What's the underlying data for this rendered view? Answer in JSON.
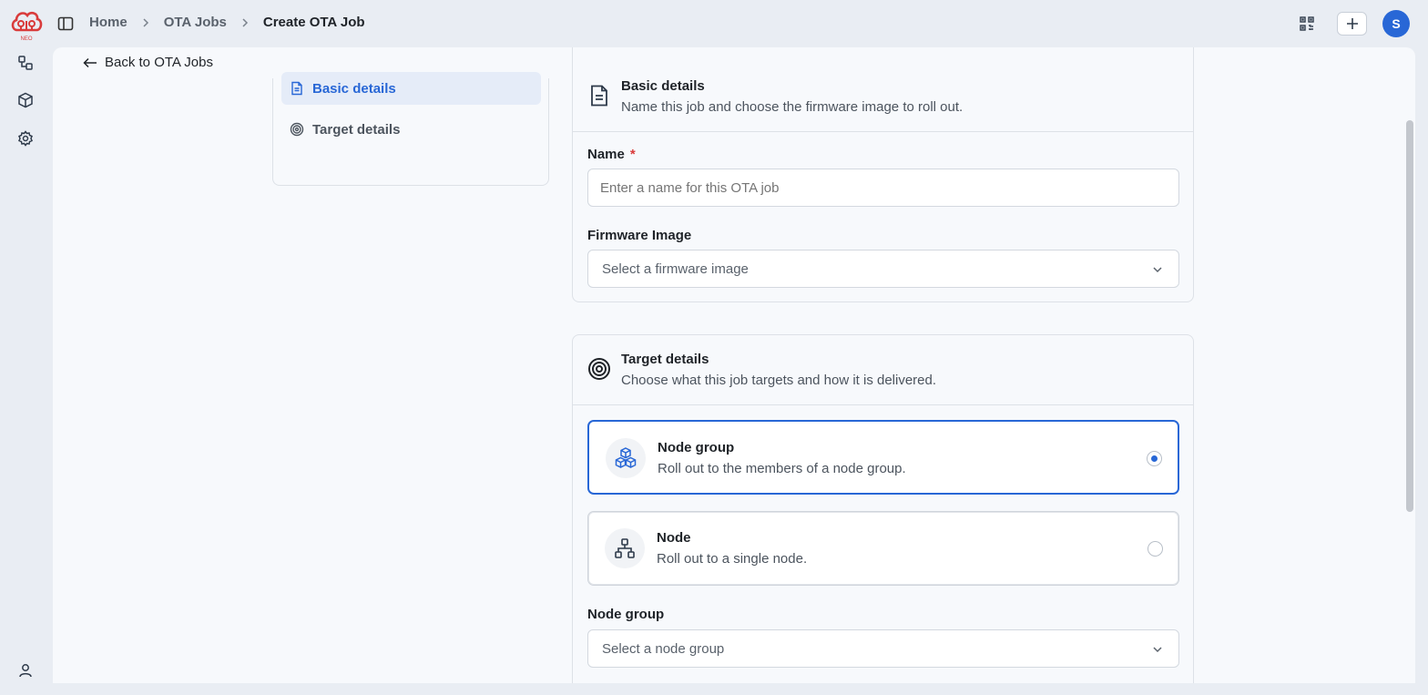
{
  "app": {
    "logo_icon": "cloud-logo-icon",
    "logo_text": "NEO"
  },
  "breadcrumb": {
    "items": [
      "Home",
      "OTA Jobs"
    ],
    "current": "Create OTA Job"
  },
  "topbar": {
    "qr_icon": "qr-code-icon",
    "add_icon": "plus-icon",
    "avatar_initial": "S"
  },
  "rail": {
    "items": [
      "nodes-icon",
      "package-icon",
      "settings-icon"
    ],
    "bottom": "user-icon"
  },
  "back_link": {
    "label": "Back to OTA Jobs"
  },
  "section_nav": {
    "items": [
      {
        "label": "Basic details",
        "icon": "document-icon",
        "active": true
      },
      {
        "label": "Target details",
        "icon": "target-icon",
        "active": false
      }
    ]
  },
  "basic_details": {
    "title": "Basic details",
    "subtitle": "Name this job and choose the firmware image to roll out.",
    "name_label": "Name",
    "required_mark": "*",
    "name_placeholder": "Enter a name for this OTA job",
    "firmware_label": "Firmware Image",
    "firmware_placeholder": "Select a firmware image"
  },
  "target_details": {
    "title": "Target details",
    "subtitle": "Choose what this job targets and how it is delivered.",
    "options": [
      {
        "title": "Node group",
        "description": "Roll out to the members of a node group.",
        "icon": "boxes-icon",
        "selected": true
      },
      {
        "title": "Node",
        "description": "Roll out to a single node.",
        "icon": "network-icon",
        "selected": false
      }
    ],
    "node_group_label": "Node group",
    "node_group_placeholder": "Select a node group"
  },
  "colors": {
    "accent": "#2867d6",
    "required": "#d93b3b",
    "logo": "#d93b3b"
  }
}
